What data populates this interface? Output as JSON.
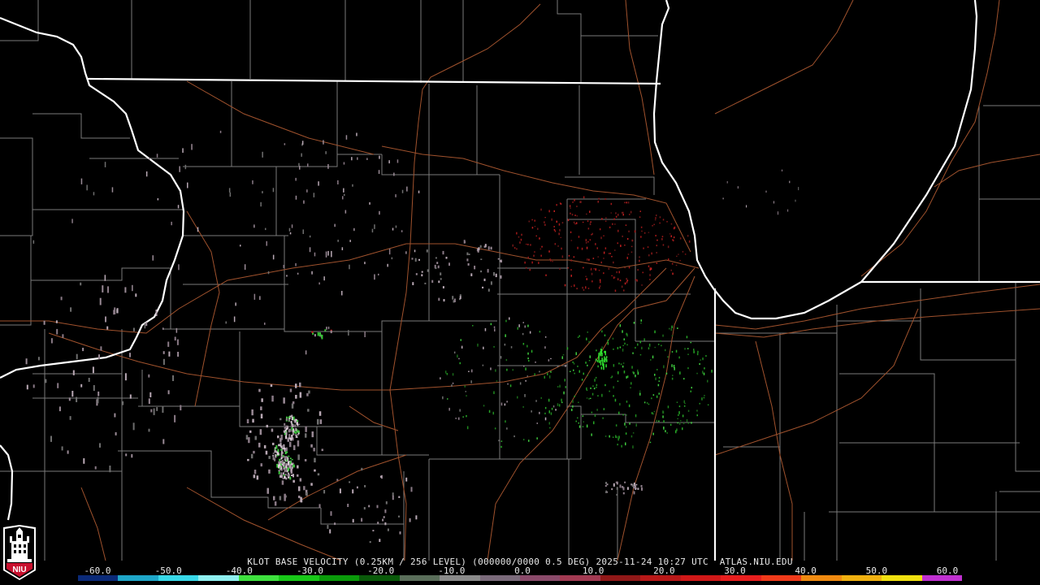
{
  "caption": "KLOT BASE VELOCITY (0.25KM / 256 LEVEL) (000000/0000 0.5 DEG) 2025-11-24 10:27 UTC  ATLAS.NIU.EDU",
  "logo_text": "NIU",
  "legend": {
    "tick_labels": [
      "-60.0",
      "-50.0",
      "-40.0",
      "-30.0",
      "-20.0",
      "-10.0",
      "0.0",
      "10.0",
      "20.0",
      "30.0",
      "40.0",
      "50.0",
      "60.0"
    ],
    "colors": [
      "#0b2a78",
      "#1ea6c8",
      "#38d8e8",
      "#8ff0f0",
      "#3ee03e",
      "#18c818",
      "#0a9a0a",
      "#0a5a0a",
      "#5a6e5a",
      "#8a8a8a",
      "#7a6a7a",
      "#8a4a6a",
      "#a23a52",
      "#901818",
      "#b81818",
      "#d01818",
      "#e81e1e",
      "#f03a1a",
      "#f08a10",
      "#f0b010",
      "#f0e010",
      "#c030d0"
    ],
    "accent_colors": {
      "background": "#000000",
      "county_lines": "#7a7a7a",
      "state_lines": "#ffffff",
      "roads": "#a0522d"
    }
  }
}
